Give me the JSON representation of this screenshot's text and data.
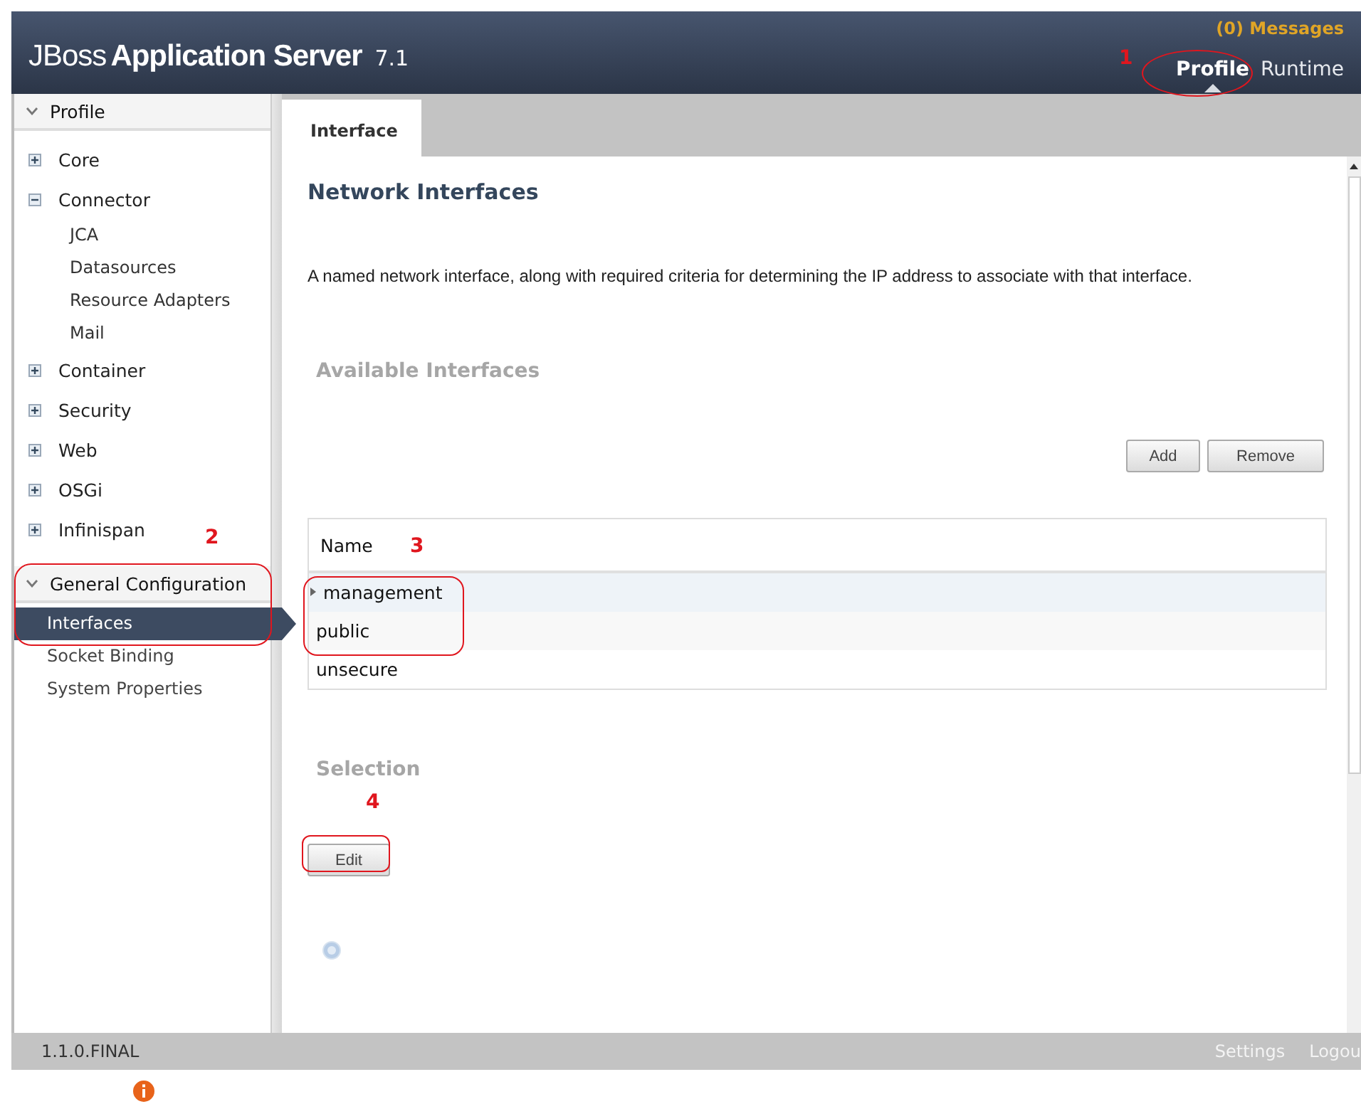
{
  "header": {
    "brand_light": "JBoss",
    "brand_bold": "Application Server",
    "version": "7.1",
    "messages": "(0) Messages",
    "nav": [
      {
        "label": "Profile",
        "selected": true
      },
      {
        "label": "Runtime",
        "selected": false
      }
    ]
  },
  "sidebar": {
    "sections": [
      {
        "title": "Profile",
        "kind": "tree",
        "items": [
          {
            "label": "Core",
            "expanded": false
          },
          {
            "label": "Connector",
            "expanded": true,
            "children": [
              {
                "label": "JCA"
              },
              {
                "label": "Datasources"
              },
              {
                "label": "Resource Adapters"
              },
              {
                "label": "Mail"
              }
            ]
          },
          {
            "label": "Container",
            "expanded": false
          },
          {
            "label": "Security",
            "expanded": false
          },
          {
            "label": "Web",
            "expanded": false
          },
          {
            "label": "OSGi",
            "expanded": false
          },
          {
            "label": "Infinispan",
            "expanded": false
          }
        ]
      },
      {
        "title": "General Configuration",
        "kind": "links",
        "items": [
          {
            "label": "Interfaces",
            "selected": true
          },
          {
            "label": "Socket Binding",
            "selected": false
          },
          {
            "label": "System Properties",
            "selected": false
          }
        ]
      }
    ]
  },
  "tabs": [
    {
      "label": "Interface",
      "selected": true
    }
  ],
  "content": {
    "title": "Network Interfaces",
    "description": "A named network interface, along with required criteria for determining the IP address to associate with that interface.",
    "available_title": "Available Interfaces",
    "buttons": [
      "Add",
      "Remove"
    ],
    "table": {
      "columns": [
        "Name"
      ],
      "rows": [
        {
          "name": "management",
          "selected": true
        },
        {
          "name": "public",
          "selected": false
        },
        {
          "name": "unsecure",
          "selected": false
        }
      ]
    },
    "selection_title": "Selection",
    "edit_button": "Edit"
  },
  "footer": {
    "version": "1.1.0.FINAL",
    "links": [
      "Settings",
      "Logou"
    ]
  },
  "annotations": [
    {
      "label": "1"
    },
    {
      "label": "2"
    },
    {
      "label": "3"
    },
    {
      "label": "4"
    }
  ]
}
